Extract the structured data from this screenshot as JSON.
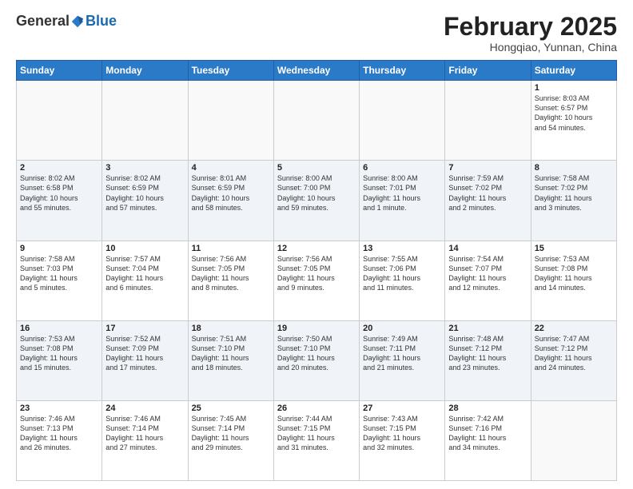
{
  "logo": {
    "general": "General",
    "blue": "Blue"
  },
  "header": {
    "month_year": "February 2025",
    "location": "Hongqiao, Yunnan, China"
  },
  "weekdays": [
    "Sunday",
    "Monday",
    "Tuesday",
    "Wednesday",
    "Thursday",
    "Friday",
    "Saturday"
  ],
  "weeks": [
    [
      {
        "day": "",
        "info": ""
      },
      {
        "day": "",
        "info": ""
      },
      {
        "day": "",
        "info": ""
      },
      {
        "day": "",
        "info": ""
      },
      {
        "day": "",
        "info": ""
      },
      {
        "day": "",
        "info": ""
      },
      {
        "day": "1",
        "info": "Sunrise: 8:03 AM\nSunset: 6:57 PM\nDaylight: 10 hours\nand 54 minutes."
      }
    ],
    [
      {
        "day": "2",
        "info": "Sunrise: 8:02 AM\nSunset: 6:58 PM\nDaylight: 10 hours\nand 55 minutes."
      },
      {
        "day": "3",
        "info": "Sunrise: 8:02 AM\nSunset: 6:59 PM\nDaylight: 10 hours\nand 57 minutes."
      },
      {
        "day": "4",
        "info": "Sunrise: 8:01 AM\nSunset: 6:59 PM\nDaylight: 10 hours\nand 58 minutes."
      },
      {
        "day": "5",
        "info": "Sunrise: 8:00 AM\nSunset: 7:00 PM\nDaylight: 10 hours\nand 59 minutes."
      },
      {
        "day": "6",
        "info": "Sunrise: 8:00 AM\nSunset: 7:01 PM\nDaylight: 11 hours\nand 1 minute."
      },
      {
        "day": "7",
        "info": "Sunrise: 7:59 AM\nSunset: 7:02 PM\nDaylight: 11 hours\nand 2 minutes."
      },
      {
        "day": "8",
        "info": "Sunrise: 7:58 AM\nSunset: 7:02 PM\nDaylight: 11 hours\nand 3 minutes."
      }
    ],
    [
      {
        "day": "9",
        "info": "Sunrise: 7:58 AM\nSunset: 7:03 PM\nDaylight: 11 hours\nand 5 minutes."
      },
      {
        "day": "10",
        "info": "Sunrise: 7:57 AM\nSunset: 7:04 PM\nDaylight: 11 hours\nand 6 minutes."
      },
      {
        "day": "11",
        "info": "Sunrise: 7:56 AM\nSunset: 7:05 PM\nDaylight: 11 hours\nand 8 minutes."
      },
      {
        "day": "12",
        "info": "Sunrise: 7:56 AM\nSunset: 7:05 PM\nDaylight: 11 hours\nand 9 minutes."
      },
      {
        "day": "13",
        "info": "Sunrise: 7:55 AM\nSunset: 7:06 PM\nDaylight: 11 hours\nand 11 minutes."
      },
      {
        "day": "14",
        "info": "Sunrise: 7:54 AM\nSunset: 7:07 PM\nDaylight: 11 hours\nand 12 minutes."
      },
      {
        "day": "15",
        "info": "Sunrise: 7:53 AM\nSunset: 7:08 PM\nDaylight: 11 hours\nand 14 minutes."
      }
    ],
    [
      {
        "day": "16",
        "info": "Sunrise: 7:53 AM\nSunset: 7:08 PM\nDaylight: 11 hours\nand 15 minutes."
      },
      {
        "day": "17",
        "info": "Sunrise: 7:52 AM\nSunset: 7:09 PM\nDaylight: 11 hours\nand 17 minutes."
      },
      {
        "day": "18",
        "info": "Sunrise: 7:51 AM\nSunset: 7:10 PM\nDaylight: 11 hours\nand 18 minutes."
      },
      {
        "day": "19",
        "info": "Sunrise: 7:50 AM\nSunset: 7:10 PM\nDaylight: 11 hours\nand 20 minutes."
      },
      {
        "day": "20",
        "info": "Sunrise: 7:49 AM\nSunset: 7:11 PM\nDaylight: 11 hours\nand 21 minutes."
      },
      {
        "day": "21",
        "info": "Sunrise: 7:48 AM\nSunset: 7:12 PM\nDaylight: 11 hours\nand 23 minutes."
      },
      {
        "day": "22",
        "info": "Sunrise: 7:47 AM\nSunset: 7:12 PM\nDaylight: 11 hours\nand 24 minutes."
      }
    ],
    [
      {
        "day": "23",
        "info": "Sunrise: 7:46 AM\nSunset: 7:13 PM\nDaylight: 11 hours\nand 26 minutes."
      },
      {
        "day": "24",
        "info": "Sunrise: 7:46 AM\nSunset: 7:14 PM\nDaylight: 11 hours\nand 27 minutes."
      },
      {
        "day": "25",
        "info": "Sunrise: 7:45 AM\nSunset: 7:14 PM\nDaylight: 11 hours\nand 29 minutes."
      },
      {
        "day": "26",
        "info": "Sunrise: 7:44 AM\nSunset: 7:15 PM\nDaylight: 11 hours\nand 31 minutes."
      },
      {
        "day": "27",
        "info": "Sunrise: 7:43 AM\nSunset: 7:15 PM\nDaylight: 11 hours\nand 32 minutes."
      },
      {
        "day": "28",
        "info": "Sunrise: 7:42 AM\nSunset: 7:16 PM\nDaylight: 11 hours\nand 34 minutes."
      },
      {
        "day": "",
        "info": ""
      }
    ]
  ]
}
